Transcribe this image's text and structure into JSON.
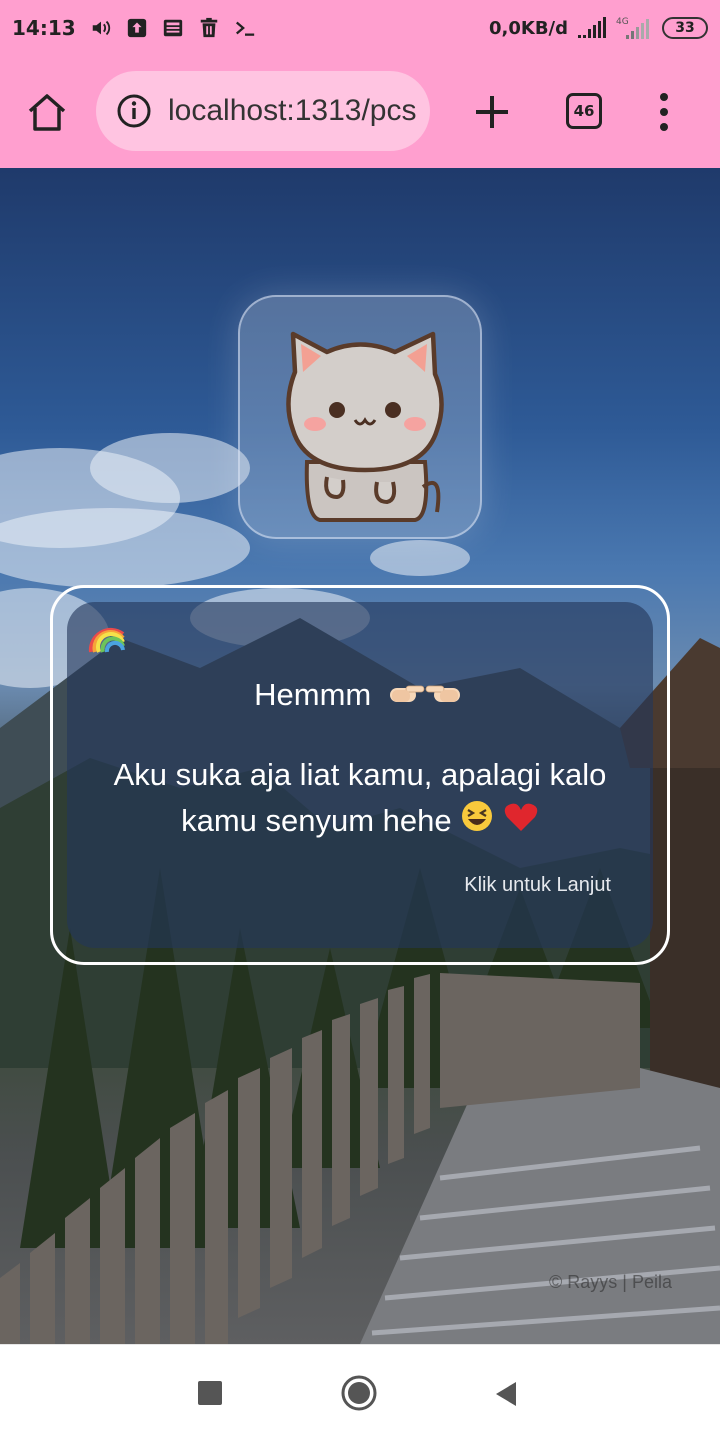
{
  "status_bar": {
    "time": "14:13",
    "net_speed": "0,0KB/d",
    "network_type": "4G",
    "battery": "33",
    "icons": [
      "volume-icon",
      "upload-icon",
      "news-icon",
      "trash-icon",
      "terminal-icon",
      "signal-icon",
      "signal-4g-icon",
      "battery-icon"
    ]
  },
  "browser": {
    "url": "localhost:1313/pcs",
    "tab_count": "46"
  },
  "page": {
    "message_title": "Hemmm",
    "message_body_line1": "Aku suka aja liat kamu, apalagi kalo",
    "message_body_line2": "kamu senyum hehe",
    "continue_label": "Klik untuk Lanjut",
    "watermark": "© Rayys | Peila",
    "decor_emojis": [
      "rainbow",
      "pointing-right",
      "pointing-left",
      "laughing-face",
      "red-heart"
    ]
  },
  "colors": {
    "chrome": "#ff9fcf",
    "url_pill": "#ffc4e1",
    "card_border": "#ffffff"
  },
  "nav_bar": {
    "buttons": [
      "recents",
      "home",
      "back"
    ]
  }
}
